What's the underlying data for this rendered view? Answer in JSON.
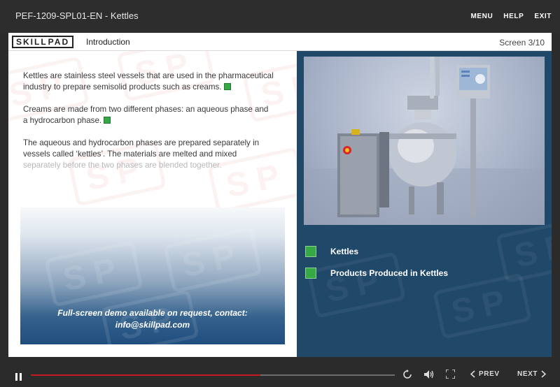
{
  "topbar": {
    "course_title": "PEF-1209-SPL01-EN - Kettles",
    "menu_label": "MENU",
    "help_label": "HELP",
    "exit_label": "EXIT"
  },
  "header": {
    "logo_text_left": "SKILL",
    "logo_text_right": "PAD",
    "section_title": "Introduction",
    "screen_counter": "Screen 3/10"
  },
  "content": {
    "paragraphs": [
      "Kettles are stainless steel vessels that are used in the pharmaceutical industry to prepare semisolid products such as creams.",
      "Creams are made from two different phases: an aqueous phase and a hydrocarbon phase.",
      "The aqueous and hydrocarbon phases are prepared separately in vessels called ‘kettles’. The materials are melted and mixed"
    ],
    "paragraph3_faded": "separately before the two phases are blended together.",
    "demo_line1": "Full-screen demo available on request, contact:",
    "demo_line2": "info@skillpad.com"
  },
  "sidepanel": {
    "items": [
      {
        "label": "Kettles"
      },
      {
        "label": "Products Produced in Kettles"
      }
    ]
  },
  "player": {
    "progress": 0.63,
    "prev_label": "PREV",
    "next_label": "NEXT"
  },
  "colors": {
    "accent_green": "#36a844",
    "panel_blue": "#204869",
    "progress_red": "#c41a22",
    "chrome_dark": "#2b2b2b"
  },
  "icons": [
    "pause-icon",
    "replay-icon",
    "volume-icon",
    "fullscreen-icon",
    "chevron-left-icon",
    "chevron-right-icon"
  ]
}
